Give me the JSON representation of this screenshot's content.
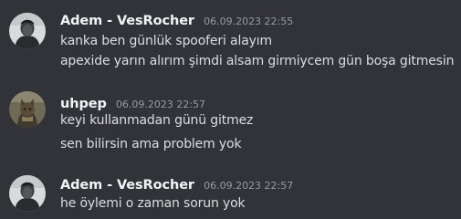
{
  "messages": [
    {
      "author": "Adem - VesRocher",
      "timestamp": "06.09.2023 22:55",
      "avatar_icon": "user-avatar-icon",
      "lines": [
        "kanka ben günlük spooferi alayım",
        "apexide yarın alırım şimdi alsam girmiycem gün boşa gitmesin"
      ]
    },
    {
      "author": "uhpep",
      "timestamp": "06.09.2023 22:57",
      "avatar_icon": "cat-avatar-icon",
      "lines": [
        "keyi kullanmadan günü gitmez",
        "sen bilirsin ama problem yok"
      ]
    },
    {
      "author": "Adem - VesRocher",
      "timestamp": "06.09.2023 22:57",
      "avatar_icon": "user-avatar-icon",
      "lines": [
        "he öylemi o zaman sorun yok"
      ]
    }
  ],
  "colors": {
    "background": "#313338",
    "username": "#f2f3f5",
    "timestamp": "#949ba4",
    "message_text": "#dbdee1"
  }
}
